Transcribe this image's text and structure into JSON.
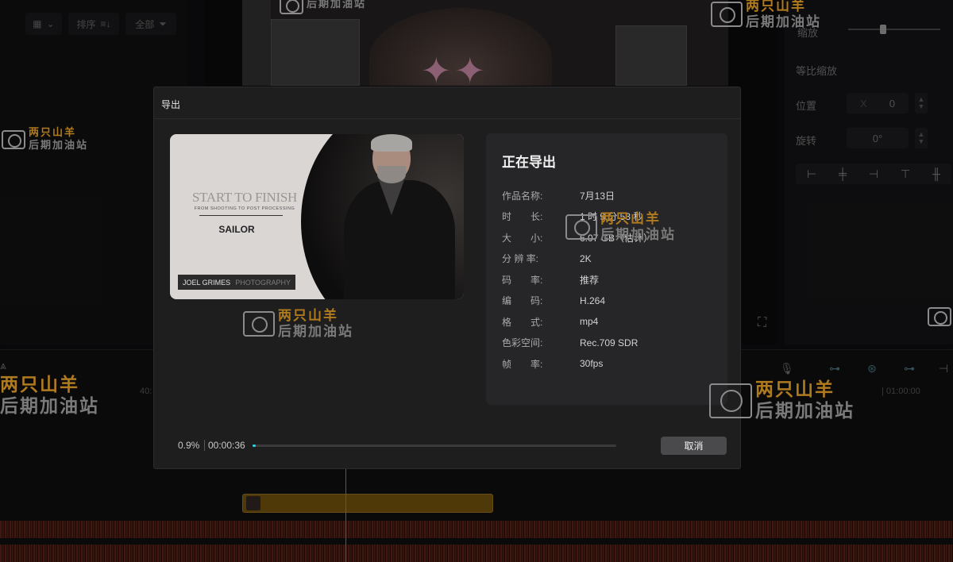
{
  "app": {
    "left_toolbar": {
      "sort_label": "排序",
      "all_label": "全部"
    },
    "right_panel": {
      "scale_label": "缩放",
      "uniform_scale_label": "等比缩放",
      "position_label": "位置",
      "position_axis": "X",
      "position_x_value": "0",
      "rotation_label": "旋转",
      "rotation_value": "0°",
      "scale_slider_value": 0.35
    },
    "timeline": {
      "time_mark_left": "40:",
      "time_mark_right": "| 01:00:00"
    }
  },
  "export_dialog": {
    "title": "导出",
    "thumbnail": {
      "heading": "START TO FINISH",
      "subheading": "FROM SHOOTING TO POST PROCESSING",
      "name": "SAILOR",
      "badge_name": "JOEL GRIMES",
      "badge_sub": "PHOTOGRAPHY"
    },
    "status_title": "正在导出",
    "details": [
      {
        "label": "作品名称:",
        "value": "7月13日"
      },
      {
        "label": "时　　长:",
        "value": "1 时 9 分 53 秒"
      },
      {
        "label": "大　　小:",
        "value": "6.07 GB（估计）"
      },
      {
        "label": "分 辨 率:",
        "value": "2K"
      },
      {
        "label": "码　　率:",
        "value": "推荐"
      },
      {
        "label": "编　　码:",
        "value": "H.264"
      },
      {
        "label": "格　　式:",
        "value": "mp4"
      },
      {
        "label": "色彩空间:",
        "value": "Rec.709 SDR"
      },
      {
        "label": "帧　　率:",
        "value": "30fps"
      }
    ],
    "progress": {
      "percent_text": "0.9%",
      "percent": 0.009,
      "elapsed": "00:00:36"
    },
    "cancel_label": "取消"
  },
  "watermark": {
    "line1": "两只山羊",
    "line2": "后期加油站"
  },
  "colors": {
    "progress_fill": "#2ad4e4",
    "watermark_brand": "#b07a1f"
  }
}
